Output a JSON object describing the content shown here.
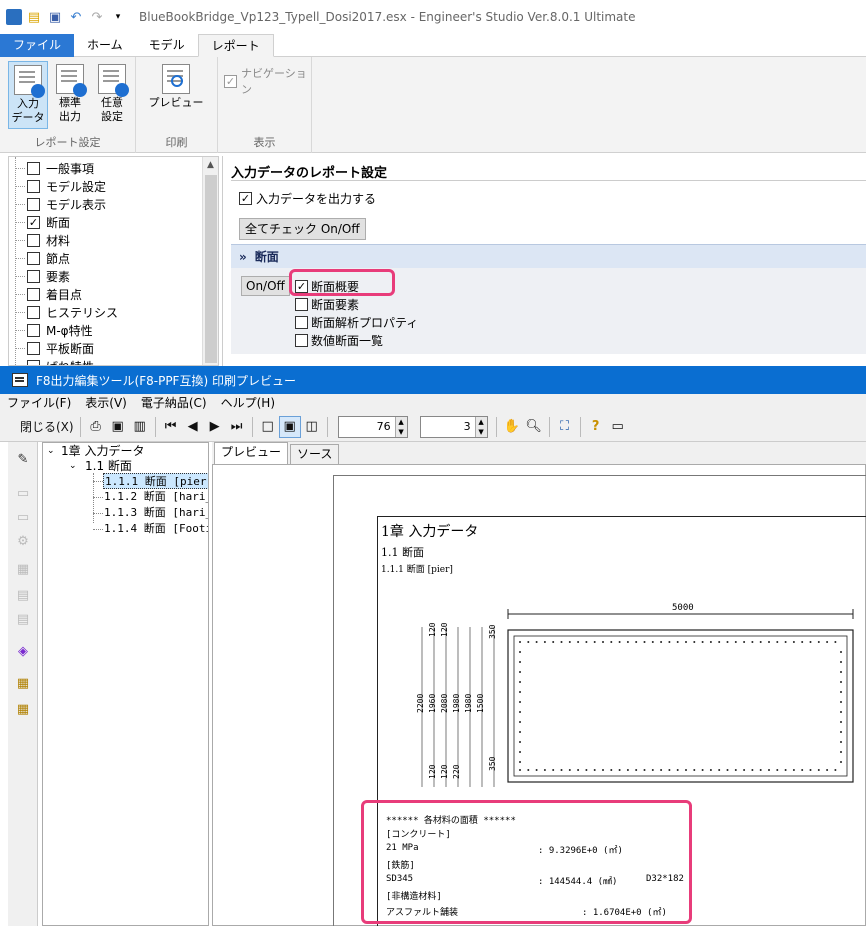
{
  "main_window": {
    "title": "BlueBookBridge_Vp123_Typell_Dosi2017.esx - Engineer's Studio Ver.8.0.1 Ultimate",
    "ribbon_tabs": [
      "ファイル",
      "ホーム",
      "モデル",
      "レポート"
    ],
    "ribbon": {
      "btn_input": "入力\nデータ",
      "btn_standard": "標準\n出力",
      "btn_optional": "任意\n設定",
      "group_report": "レポート設定",
      "btn_preview": "プレビュー",
      "group_print": "印刷",
      "navigation_label": "ナビゲーション",
      "group_display": "表示"
    },
    "left_tree": [
      "一般事項",
      "モデル設定",
      "モデル表示",
      "断面",
      "材料",
      "節点",
      "要素",
      "着目点",
      "ヒステリシス",
      "M-φ特性",
      "平板断面",
      "ばね特性"
    ],
    "left_tree_checked_index": 3,
    "settings": {
      "title": "入力データのレポート設定",
      "output_checkbox": "入力データを出力する",
      "toggle_all_button": "全てチェック On/Off",
      "section_header": "断面",
      "onoff_button": "On/Off",
      "items": [
        "断面概要",
        "断面要素",
        "断面解析プロパティ",
        "数値断面一覧"
      ]
    }
  },
  "preview_window": {
    "title": "F8出力編集ツール(F8-PPF互換) 印刷プレビュー",
    "menu": [
      "ファイル(F)",
      "表示(V)",
      "電子納品(C)",
      "ヘルプ(H)"
    ],
    "close_button": "閉じる(X)",
    "zoom_value": "76",
    "page_value": "3",
    "tree": {
      "chapter": "1章 入力データ",
      "section": "1.1 断面",
      "items": [
        "1.1.1 断面 [pier]",
        "1.1.2 断面 [hari_",
        "1.1.3 断面 [hari_",
        "1.1.4 断面 [Footi"
      ]
    },
    "tabs": [
      "プレビュー",
      "ソース"
    ],
    "page": {
      "chapter": "1章 入力データ",
      "section": "1.1 断面",
      "subsection": "1.1.1 断面 [pier]",
      "drawing": {
        "width_label": "5000",
        "left_dims": [
          "2200",
          "1960",
          "2080",
          "1980",
          "1980",
          "1500",
          "120",
          "120",
          "350",
          "120",
          "120",
          "220",
          "350"
        ]
      },
      "materials": {
        "header": "****** 各材料の面積 ******",
        "concrete_label": "[コンクリート]",
        "concrete_name": "21 MPa",
        "concrete_value": ": 9.3296E+0 (㎡)",
        "rebar_label": "[鉄筋]",
        "rebar_name": "SD345",
        "rebar_value": ": 144544.4 (㎟)",
        "rebar_spec": "D32*182",
        "nonstruct_label": "[非構造材料]",
        "nonstruct_name": "アスファルト舗装",
        "nonstruct_value": ": 1.6704E+0 (㎡)"
      }
    }
  },
  "colors": {
    "file_tab": "#2b78d4",
    "preview_titlebar": "#0a6ed1",
    "highlight": "#e83c7a",
    "section_header": "#dce6f4"
  }
}
